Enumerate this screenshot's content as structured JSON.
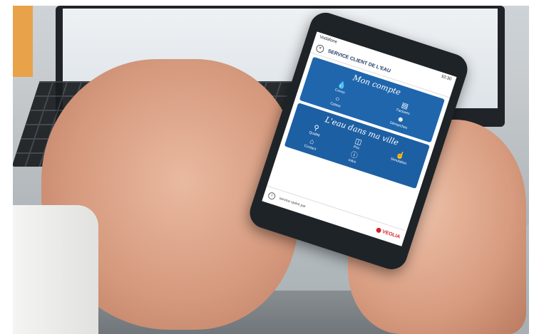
{
  "status": {
    "carrier": "Vodafone",
    "time": "10:30"
  },
  "header": {
    "title": "SERVICE CLIENT DE L'EAU"
  },
  "panel1": {
    "title": "Mon compte",
    "tiles": [
      {
        "icon": "drop",
        "label": "Conso"
      },
      {
        "icon": "document",
        "label": "Factures"
      },
      {
        "icon": "circle",
        "label": "Cpteur"
      },
      {
        "icon": "users",
        "label": "Démarches"
      }
    ]
  },
  "panel2": {
    "title": "L'eau dans ma ville",
    "tiles": [
      {
        "icon": "faucet",
        "label": "Qualité"
      },
      {
        "icon": "glass",
        "label": "Prix"
      },
      {
        "icon": "hand-pointer",
        "label": "Simulation"
      },
      {
        "icon": "house",
        "label": "Contact"
      },
      {
        "icon": "info",
        "label": "Infos"
      }
    ]
  },
  "footer": {
    "text": "service opéré par",
    "brand": "VEOLIA"
  }
}
